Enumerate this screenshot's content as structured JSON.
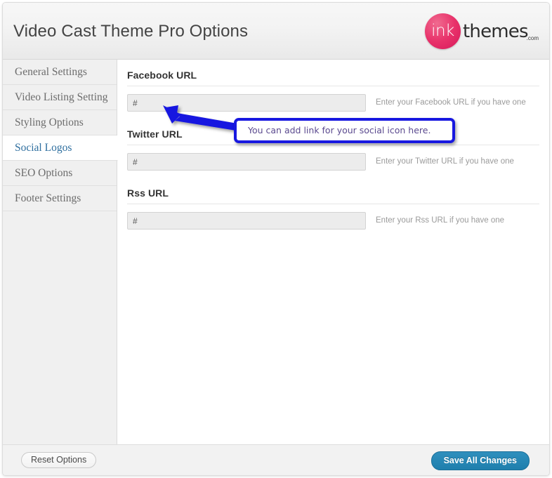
{
  "header": {
    "title": "Video Cast Theme Pro Options",
    "logo": {
      "mark_text": "ink",
      "word_text": "themes",
      "tld_text": ".com",
      "circle_color": "#e8316a",
      "word_color": "#2e2e2e"
    }
  },
  "sidebar": {
    "items": [
      {
        "label": "General Settings",
        "active": false
      },
      {
        "label": "Video Listing Setting",
        "active": false
      },
      {
        "label": "Styling Options",
        "active": false
      },
      {
        "label": "Social Logos",
        "active": true
      },
      {
        "label": "SEO Options",
        "active": false
      },
      {
        "label": "Footer Settings",
        "active": false
      }
    ],
    "active_text_color": "#2f6f9f",
    "idle_text_color": "#6c6c6c"
  },
  "content": {
    "fields": [
      {
        "label": "Facebook URL",
        "value": "#",
        "placeholder": "#",
        "description": "Enter your Facebook URL if you have one"
      },
      {
        "label": "Twitter URL",
        "value": "#",
        "placeholder": "#",
        "description": "Enter your Twitter URL if you have one"
      },
      {
        "label": "Rss URL",
        "value": "#",
        "placeholder": "#",
        "description": "Enter your Rss URL if you have one"
      }
    ]
  },
  "footer": {
    "reset_label": "Reset Options",
    "save_label": "Save All Changes",
    "save_color": "#1f7fad"
  },
  "annotation": {
    "callout_text": "You can add link for your social icon here.",
    "border_color": "#1818e0",
    "text_color": "#5b4a8f",
    "arrow_color": "#1818e0"
  }
}
